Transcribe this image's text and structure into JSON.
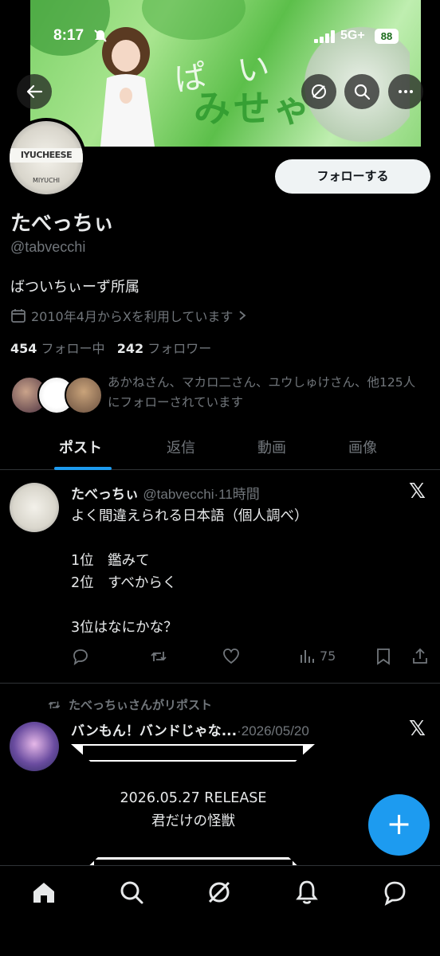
{
  "status_bar": {
    "time": "8:17",
    "network": "5G+",
    "battery": "88"
  },
  "header": {
    "back_icon": "arrow-left-icon",
    "grok_icon": "grok-icon",
    "search_icon": "search-icon",
    "more_icon": "more-horizontal-icon"
  },
  "profile": {
    "avatar_text": "IYUCHEESE",
    "avatar_sub": "MIYUCHI",
    "follow_button": "フォローする",
    "name": "たべっちぃ",
    "handle": "@tabvecchi",
    "bio": "ばついちぃーず所属",
    "joined": "2010年4月からXを利用しています",
    "following_count": "454",
    "following_label": "フォロー中",
    "followers_count": "242",
    "followers_label": "フォロワー",
    "followed_by": "あかねさん、マカロ二さん、ユウしゅけさん、他125人にフォローされています"
  },
  "tabs": [
    {
      "label": "ポスト",
      "active": true
    },
    {
      "label": "返信",
      "active": false
    },
    {
      "label": "動画",
      "active": false
    },
    {
      "label": "画像",
      "active": false
    }
  ],
  "posts": [
    {
      "name": "たべっちぃ",
      "handle": "@tabvecchi",
      "time": "·11時間",
      "lines": [
        "よく間違えられる日本語（個人調べ）",
        "",
        "1位　鑑みて",
        "2位　すべからく",
        "",
        "3位はなにかな？"
      ],
      "views": "75"
    },
    {
      "repost_label": "たべっちぃさんがリポスト",
      "name": "バンもん！バンドじゃな...",
      "time": "·2026/05/20",
      "release_line1": "2026.05.27 RELEASE",
      "release_line2": "君だけの怪獣"
    }
  ],
  "fab": {
    "label": "+"
  },
  "bottom_nav": [
    "home-icon",
    "search-icon",
    "grok-icon",
    "notifications-icon",
    "messages-icon"
  ],
  "colors": {
    "accent": "#1d9bf0",
    "background": "#000000",
    "text_primary": "#e7e9ea",
    "text_secondary": "#71767b",
    "divider": "#2f3336"
  }
}
